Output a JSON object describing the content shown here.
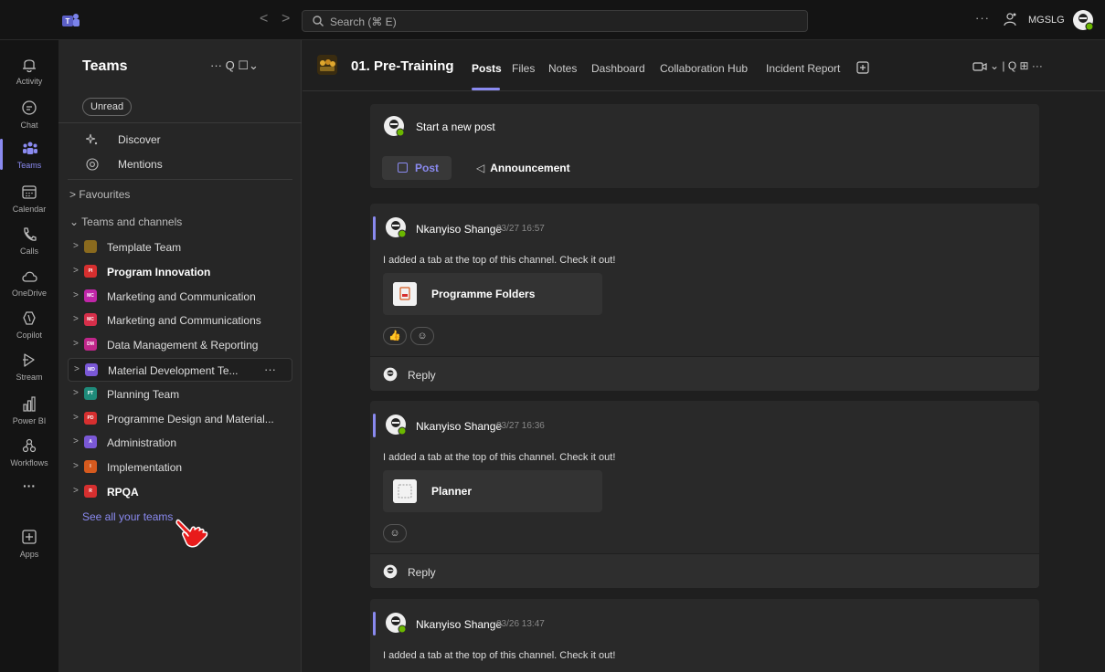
{
  "titlebar": {
    "nav_back": "<",
    "nav_forward": ">",
    "search_placeholder": "Search (⌘ E)",
    "more": "···",
    "org": "MGSLG"
  },
  "rail": {
    "items": [
      {
        "label": "Activity",
        "icon": "bell-icon"
      },
      {
        "label": "Chat",
        "icon": "chat-icon"
      },
      {
        "label": "Teams",
        "icon": "teams-icon",
        "active": true
      },
      {
        "label": "Calendar",
        "icon": "calendar-icon"
      },
      {
        "label": "Calls",
        "icon": "phone-icon"
      },
      {
        "label": "OneDrive",
        "icon": "cloud-icon"
      },
      {
        "label": "Copilot",
        "icon": "copilot-icon"
      },
      {
        "label": "Stream",
        "icon": "stream-icon"
      },
      {
        "label": "Power BI",
        "icon": "chart-icon"
      },
      {
        "label": "Workflows",
        "icon": "workflow-icon"
      },
      {
        "label": "···",
        "icon": "more-icon"
      },
      {
        "label": "Apps",
        "icon": "plus-square-icon"
      }
    ]
  },
  "panel": {
    "title": "Teams",
    "actions": "···  Q  ☐⌄",
    "unread": "Unread",
    "discover": "Discover",
    "mentions": "Mentions",
    "favourites": "> Favourites",
    "teams_and_channels": "⌄ Teams and channels",
    "teams": [
      {
        "name": "Template Team",
        "initials": "",
        "color": "#8a6a1e",
        "bold": false
      },
      {
        "name": "Program Innovation",
        "initials": "PI",
        "color": "#d62f2f",
        "bold": true
      },
      {
        "name": "Marketing and Communication",
        "initials": "MC",
        "color": "#c026a8",
        "bold": false
      },
      {
        "name": "Marketing and Communications",
        "initials": "MC",
        "color": "#d62f4a",
        "bold": false
      },
      {
        "name": "Data Management & Reporting",
        "initials": "DM",
        "color": "#c0268a",
        "bold": false
      },
      {
        "name": "Material Development Te...",
        "initials": "MD",
        "color": "#7a58d6",
        "bold": false,
        "hover": true,
        "more": "···"
      },
      {
        "name": "Planning Team",
        "initials": "PT",
        "color": "#1e8a7a",
        "bold": false
      },
      {
        "name": "Programme Design and Material...",
        "initials": "PD",
        "color": "#d62f2f",
        "bold": false
      },
      {
        "name": "Administration",
        "initials": "A",
        "color": "#7a58d6",
        "bold": false
      },
      {
        "name": "Implementation",
        "initials": "I",
        "color": "#d65a1e",
        "bold": false
      },
      {
        "name": "RPQA",
        "initials": "R",
        "color": "#d62f2f",
        "bold": true
      }
    ],
    "see_all": "See all your teams"
  },
  "channel": {
    "name": "01. Pre-Training",
    "tabs": [
      "Posts",
      "Files",
      "Notes",
      "Dashboard",
      "Collaboration Hub",
      "Incident Report"
    ],
    "right_tools": "⌄   |   Q  ⊞  ···"
  },
  "new_post": {
    "prompt": "Start a new post",
    "post_button": "Post",
    "announcement_button": "Announcement"
  },
  "messages": [
    {
      "author": "Nkanyiso Shange",
      "time": "03/27 16:57",
      "body": "I added a tab at the top of this channel. Check it out!",
      "tab_name": "Programme Folders",
      "reply": "Reply"
    },
    {
      "author": "Nkanyiso Shange",
      "time": "03/27 16:36",
      "body": "I added a tab at the top of this channel. Check it out!",
      "tab_name": "Planner",
      "reply": "Reply"
    },
    {
      "author": "Nkanyiso Shange",
      "time": "03/26 13:47",
      "body": "I added a tab at the top of this channel. Check it out!"
    }
  ],
  "colors": {
    "accent": "#8a8af0",
    "presence": "#6bb700"
  }
}
